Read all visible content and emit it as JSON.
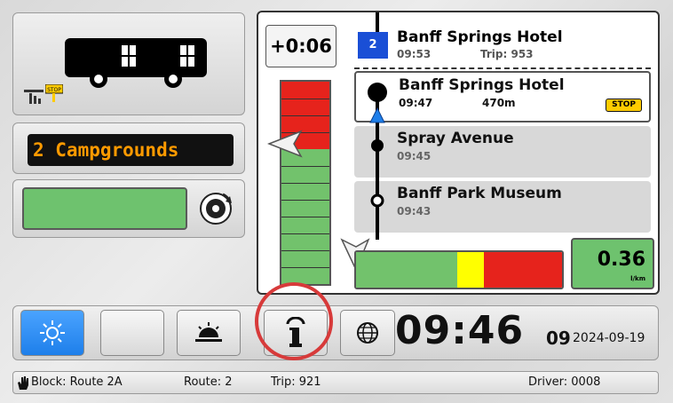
{
  "deviation": "+0:06",
  "route_sign": "2 Campgrounds",
  "next_trip": {
    "route_number": "2",
    "stop_name": "Banff Springs Hotel",
    "time": "09:53",
    "trip_label": "Trip: 953"
  },
  "stops": [
    {
      "name": "Banff Springs Hotel",
      "time": "09:47",
      "distance": "470m",
      "badge": "STOP"
    },
    {
      "name": "Spray Avenue",
      "time": "09:45"
    },
    {
      "name": "Banff Park Museum",
      "time": "09:43"
    }
  ],
  "fuel": {
    "value": "0.36",
    "unit": "l/km"
  },
  "clock": {
    "hhmm": "09:46",
    "seconds": "09",
    "date": "2024-09-19"
  },
  "status": {
    "block": "Block: Route 2A",
    "route": "Route: 2",
    "trip": "Trip: 921",
    "driver": "Driver: 0008"
  },
  "icons": {
    "bus": "bus-icon",
    "signal": "signal-icon",
    "stop_sign": "stop-sign-icon",
    "tire": "tire-icon",
    "day": "sun-icon",
    "night": "moon-icon",
    "dim": "dimmer-icon",
    "info": "info-icon",
    "globe": "globe-icon",
    "hand": "hand-icon"
  },
  "colors": {
    "late_red": "#e6231c",
    "ok_green": "#72c26c",
    "warn_yellow": "#ffff00",
    "route_sign_text": "#ff9a00",
    "active_button": "#1e7fea",
    "stop_badge": "#ffcc00"
  }
}
